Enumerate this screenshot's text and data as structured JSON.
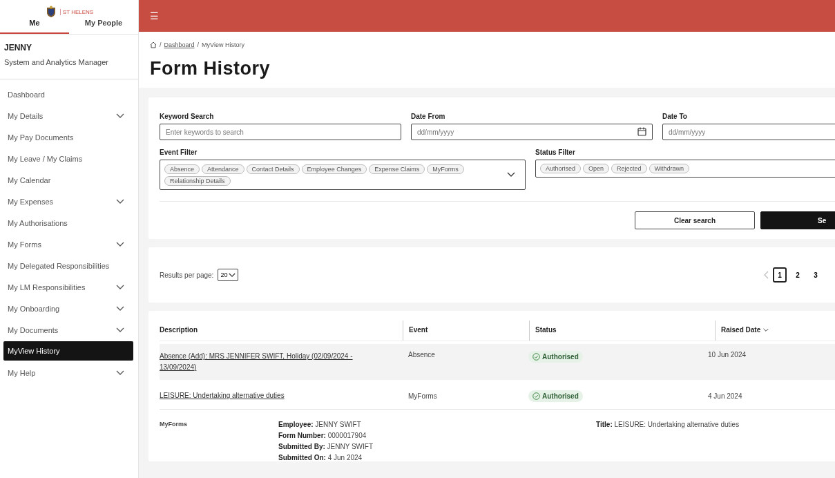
{
  "logo": {
    "name": "ST HELENS"
  },
  "sidebar": {
    "tabs": [
      {
        "label": "Me",
        "selected": true
      },
      {
        "label": "My People",
        "selected": false
      }
    ],
    "user": {
      "name": "JENNY",
      "role": "System and Analytics Manager"
    },
    "items": [
      {
        "label": "Dashboard",
        "expandable": false,
        "selected": false
      },
      {
        "label": "My Details",
        "expandable": true,
        "selected": false
      },
      {
        "label": "My Pay Documents",
        "expandable": false,
        "selected": false
      },
      {
        "label": "My Leave / My Claims",
        "expandable": false,
        "selected": false
      },
      {
        "label": "My Calendar",
        "expandable": false,
        "selected": false
      },
      {
        "label": "My Expenses",
        "expandable": true,
        "selected": false
      },
      {
        "label": "My Authorisations",
        "expandable": false,
        "selected": false
      },
      {
        "label": "My Forms",
        "expandable": true,
        "selected": false
      },
      {
        "label": "My Delegated Responsibilities",
        "expandable": false,
        "selected": false
      },
      {
        "label": "My LM Responsibilities",
        "expandable": true,
        "selected": false
      },
      {
        "label": "My Onboarding",
        "expandable": true,
        "selected": false
      },
      {
        "label": "My Documents",
        "expandable": true,
        "selected": false
      },
      {
        "label": "MyView History",
        "expandable": false,
        "selected": true
      },
      {
        "label": "My Help",
        "expandable": true,
        "selected": false
      }
    ]
  },
  "header": {
    "menu": "☰"
  },
  "breadcrumb": [
    {
      "separator": "/",
      "label": "Dashboard",
      "link": true
    },
    {
      "separator": "/",
      "label": "MyView History",
      "link": false
    }
  ],
  "title": "Form History",
  "filters": {
    "keyword": {
      "label": "Keyword Search",
      "placeholder": "Enter keywords to search"
    },
    "date_from": {
      "label": "Date From",
      "placeholder": "dd/mm/yyyy"
    },
    "date_to": {
      "label": "Date To",
      "placeholder": "dd/mm/yyyy"
    },
    "event_filter": {
      "label": "Event Filter",
      "chips": [
        "Absence",
        "Attendance",
        "Contact Details",
        "Employee Changes",
        "Expense Claims",
        "MyForms",
        "Relationship Details"
      ]
    },
    "status_filter": {
      "label": "Status Filter",
      "chips": [
        "Authorised",
        "Open",
        "Rejected",
        "Withdrawn"
      ]
    },
    "clear_button": "Clear search",
    "search_button": "Se"
  },
  "results": {
    "label": "Results per page:",
    "per_page": "20",
    "pages": [
      {
        "label": "1",
        "selected": true
      },
      {
        "label": "2",
        "selected": false
      },
      {
        "label": "3",
        "selected": false
      }
    ]
  },
  "table": {
    "columns": [
      {
        "label": "Description",
        "sorted": false
      },
      {
        "label": "Event",
        "sorted": false
      },
      {
        "label": "Status",
        "sorted": false
      },
      {
        "label": "Raised Date",
        "sorted": true
      }
    ],
    "rows": [
      {
        "description": "Absence (Add): MRS JENNIFER SWIFT, Holiday (02/09/2024 - 13/09/2024)",
        "event": "Absence",
        "status": "Authorised",
        "raised": "10 Jun 2024",
        "expanded": false
      },
      {
        "description": "LEISURE: Undertaking alternative duties",
        "event": "MyForms",
        "status": "Authorised",
        "raised": "4 Jun 2024",
        "expanded": true
      }
    ],
    "detail": {
      "type": "MyForms",
      "fields": [
        {
          "label": "Employee:",
          "value": "JENNY SWIFT"
        },
        {
          "label": "Form Number:",
          "value": "0000017904"
        },
        {
          "label": "Submitted By:",
          "value": "JENNY SWIFT"
        },
        {
          "label": "Submitted On:",
          "value": "4 Jun 2024"
        }
      ],
      "side_fields": [
        {
          "label": "Title:",
          "value": "LEISURE: Undertaking alternative duties"
        }
      ]
    }
  }
}
